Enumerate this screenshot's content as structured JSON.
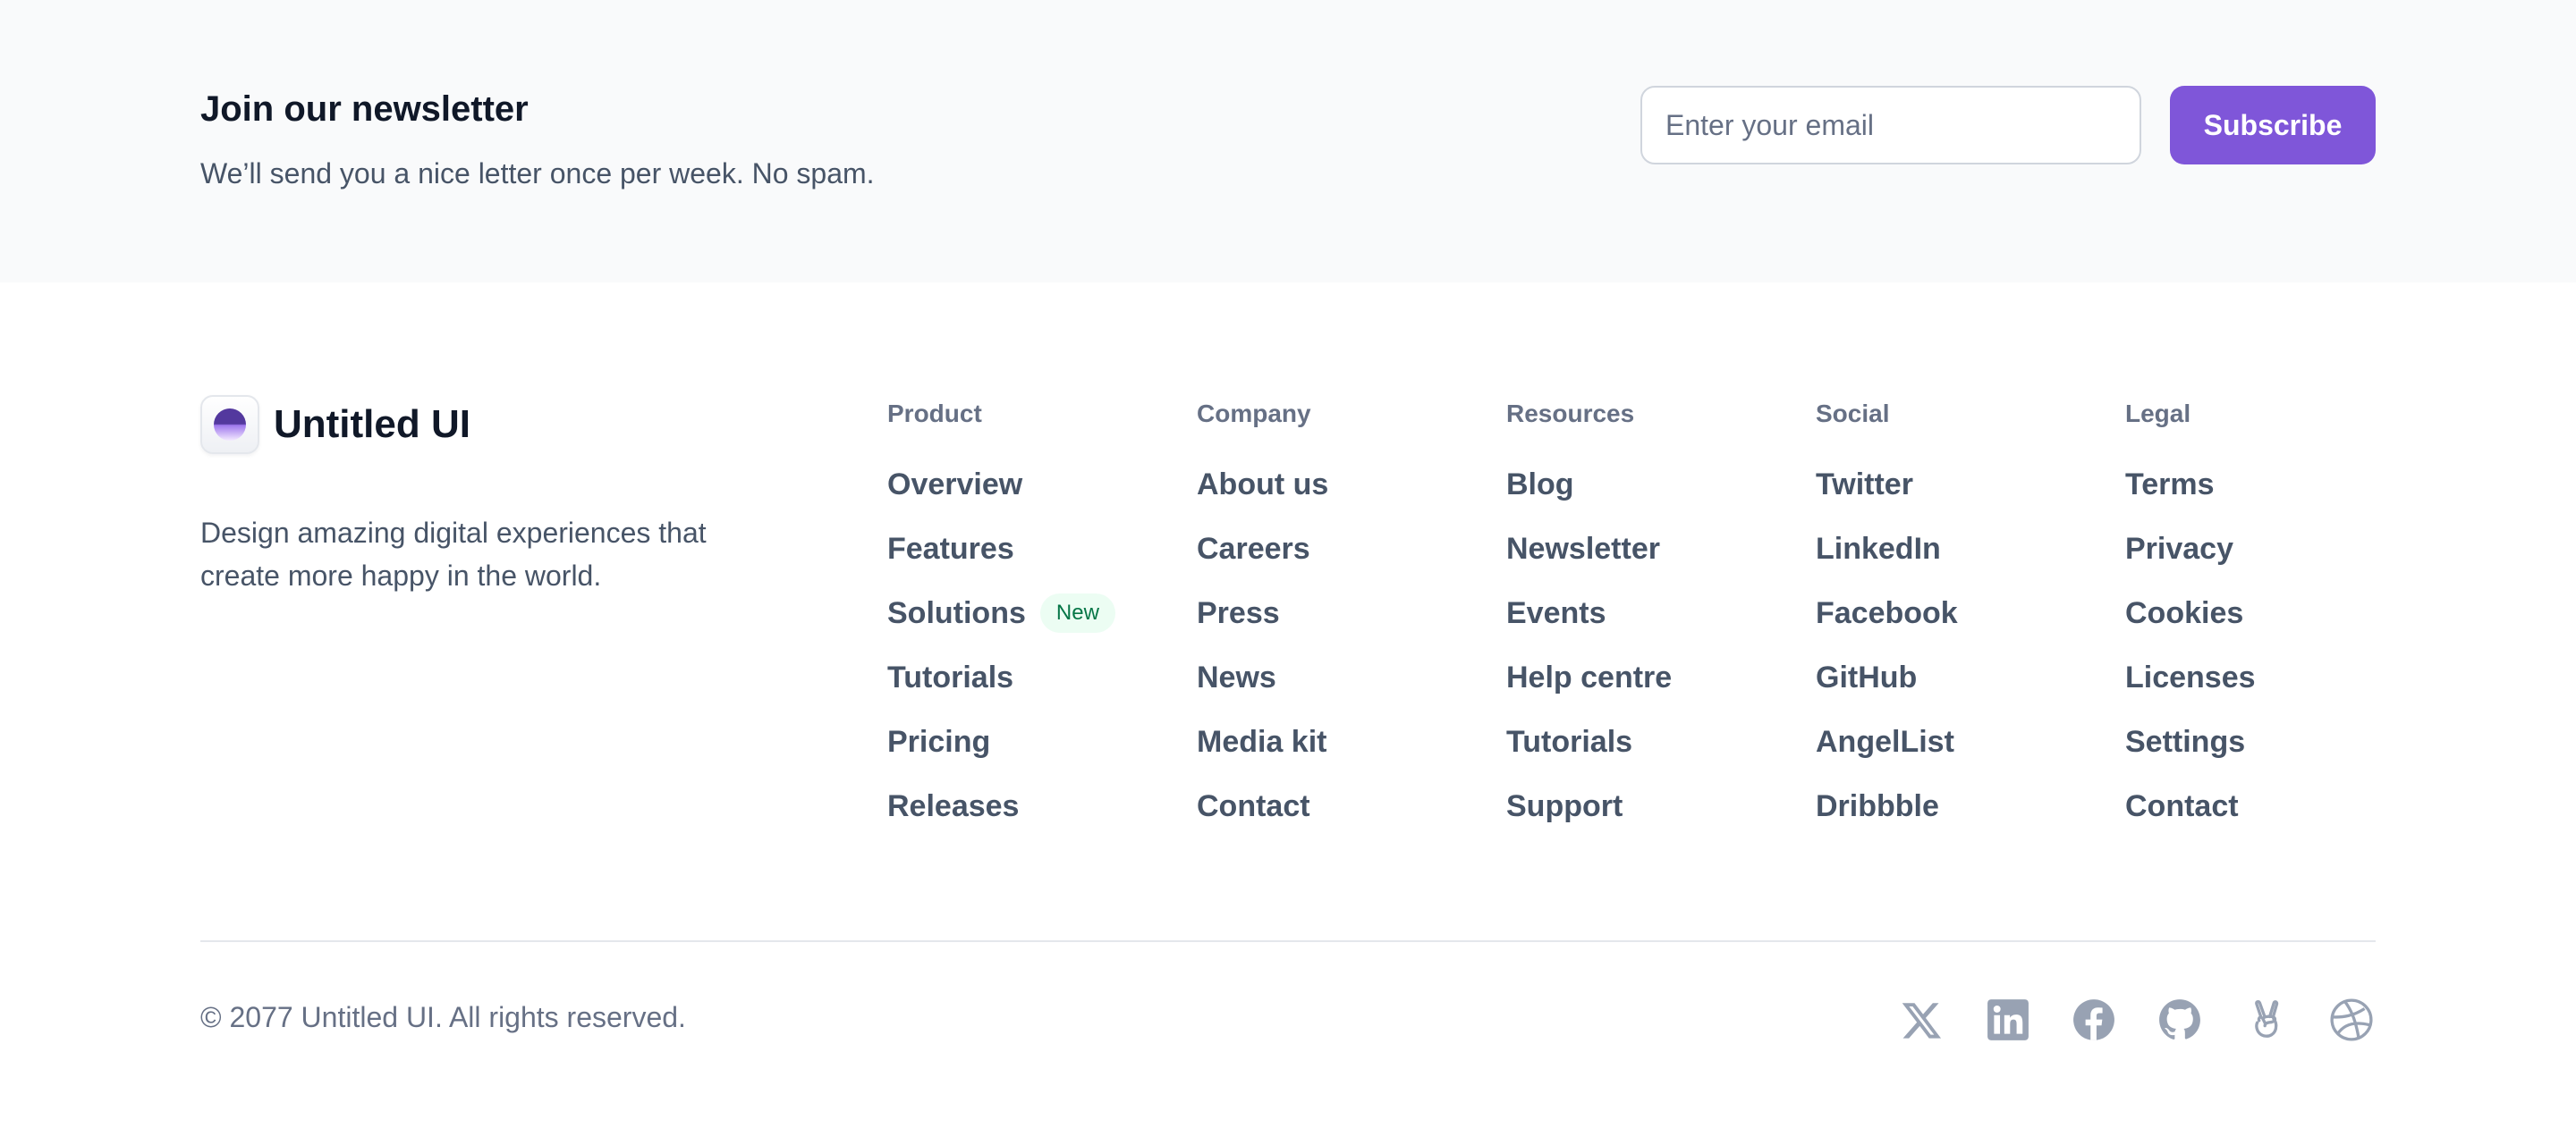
{
  "newsletter": {
    "title": "Join our newsletter",
    "subtitle": "We’ll send you a nice letter once per week. No spam.",
    "email_placeholder": "Enter your email",
    "email_value": "",
    "button_label": "Subscribe"
  },
  "brand": {
    "name": "Untitled UI",
    "description": "Design amazing digital experiences that create more happy in the world."
  },
  "columns": [
    {
      "heading": "Product",
      "links": [
        "Overview",
        "Features",
        "Solutions",
        "Tutorials",
        "Pricing",
        "Releases"
      ],
      "badge": {
        "link_index": 2,
        "label": "New"
      }
    },
    {
      "heading": "Company",
      "links": [
        "About us",
        "Careers",
        "Press",
        "News",
        "Media kit",
        "Contact"
      ]
    },
    {
      "heading": "Resources",
      "links": [
        "Blog",
        "Newsletter",
        "Events",
        "Help centre",
        "Tutorials",
        "Support"
      ]
    },
    {
      "heading": "Social",
      "links": [
        "Twitter",
        "LinkedIn",
        "Facebook",
        "GitHub",
        "AngelList",
        "Dribbble"
      ]
    },
    {
      "heading": "Legal",
      "links": [
        "Terms",
        "Privacy",
        "Cookies",
        "Licenses",
        "Settings",
        "Contact"
      ]
    }
  ],
  "footer": {
    "copyright": "© 2077 Untitled UI. All rights reserved.",
    "social_icons": [
      "x-icon",
      "linkedin-icon",
      "facebook-icon",
      "github-icon",
      "angellist-icon",
      "dribbble-icon"
    ]
  },
  "colors": {
    "accent": "#7f56d9",
    "newsletter_bg": "#f9fafb",
    "badge_bg": "#ecfdf3",
    "badge_text": "#067647",
    "icon_gray": "#98a2b3"
  }
}
